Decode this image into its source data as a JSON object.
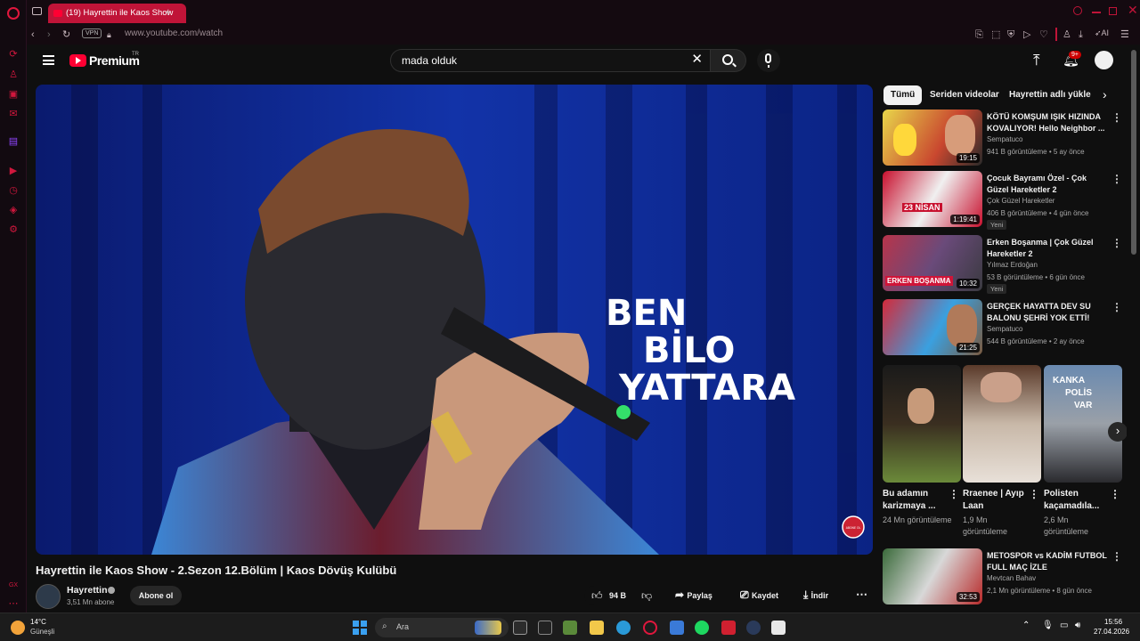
{
  "browser": {
    "tab_title": "(19) Hayrettin ile Kaos Show",
    "new_tab": "+",
    "vpn_label": "VPN",
    "url": "www.youtube.com/watch",
    "aria_label": "AI"
  },
  "youtube": {
    "logo_text": "Premium",
    "logo_region": "TR",
    "search_value": "mada olduk",
    "notifications_count": "9+",
    "video": {
      "title": "Hayrettin ile Kaos Show - 2.Sezon 12.Bölüm | Kaos Dövüş Kulübü",
      "overlay_line1": "BEN",
      "overlay_line2": "BİLO",
      "overlay_line3": "YATTARA",
      "watermark": "ABONE OL"
    },
    "channel": {
      "name": "Hayrettin",
      "subscribers": "3,51 Mn abone",
      "subscribe_label": "Abone ol"
    },
    "actions": {
      "likes": "94 B",
      "share": "Paylaş",
      "save": "Kaydet",
      "download": "İndir"
    },
    "chips": [
      "Tümü",
      "Seriden videolar",
      "Hayrettin adlı yükleyi"
    ],
    "related": [
      {
        "title": "KÖTÜ KOMŞUM IŞIK HIZINDA KOVALIYOR! Hello Neighbor ...",
        "channel": "Sempatuco",
        "meta": "941 B görüntüleme • 5 ay önce",
        "duration": "19:15",
        "badge": ""
      },
      {
        "title": "Çocuk Bayramı Özel - Çok Güzel Hareketler 2",
        "channel": "Çok Güzel Hareketler",
        "meta": "406 B görüntüleme • 4 gün önce",
        "duration": "1:19:41",
        "badge": "Yeni"
      },
      {
        "title": "Erken Boşanma | Çok Güzel Hareketler 2",
        "channel": "Yılmaz Erdoğan",
        "meta": "53 B görüntüleme • 6 gün önce",
        "duration": "10:32",
        "badge": "Yeni"
      },
      {
        "title": "GERÇEK HAYATTA DEV SU BALONU ŞEHRİ YOK ETTİ!",
        "channel": "Sempatuco",
        "meta": "544 B görüntüleme • 2 ay önce",
        "duration": "21:25",
        "badge": ""
      }
    ],
    "shorts": [
      {
        "title": "Bu adamın karizmaya ...",
        "views": "24 Mn görüntüleme"
      },
      {
        "title": "Rraenee | Ayıp Laan",
        "views": "1,9 Mn görüntüleme"
      },
      {
        "title": "Polisten kaçamadıla...",
        "views": "2,6 Mn görüntüleme"
      }
    ],
    "related_after": {
      "title": "METOSPOR vs KADİM FUTBOL FULL MAÇ İZLE",
      "channel": "Mevtcan Bahav",
      "meta": "2,1 Mn görüntüleme • 8 gün önce",
      "duration": "32:53"
    },
    "thumb_texts": {
      "t2": "23 NİSAN",
      "t3": "ERKEN BOŞANMA",
      "s3a": "KANKA",
      "s3b": "POLİS",
      "s3c": "VAR"
    }
  },
  "taskbar": {
    "temperature": "14°C",
    "weather": "Güneşli",
    "search_placeholder": "Ara",
    "time": "15:56",
    "date": "27.04.2026"
  }
}
